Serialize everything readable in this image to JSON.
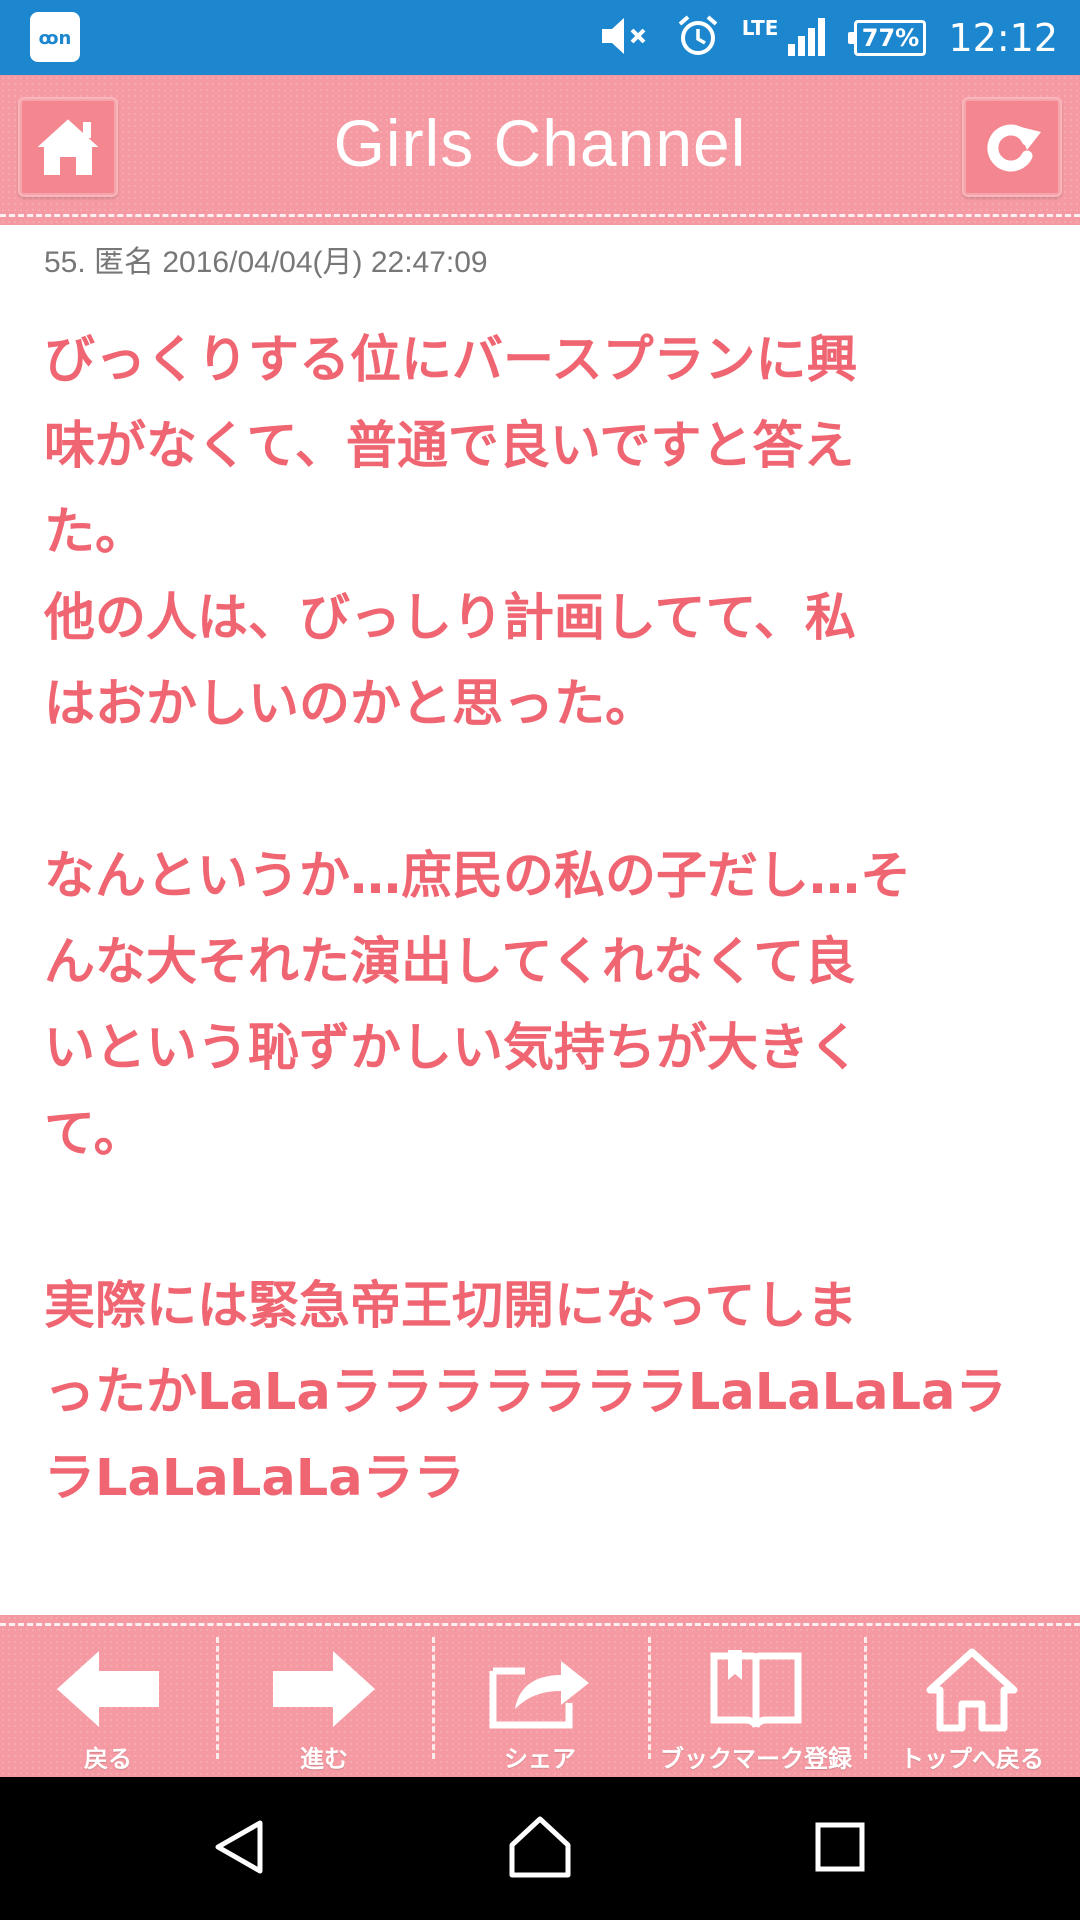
{
  "status_bar": {
    "time": "12:12",
    "network": "LTE",
    "battery": "77%",
    "icons": [
      "app-notification-icon",
      "volume-muted-icon",
      "alarm-icon",
      "signal-icon",
      "battery-icon"
    ]
  },
  "header": {
    "title": "Girls Channel",
    "home_icon": "home-icon",
    "reload_icon": "reload-icon"
  },
  "comment": {
    "meta": "55. 匿名 2016/04/04(月) 22:47:09",
    "paragraphs": [
      "びっくりする位にバースプランに興\n味がなくて、普通で良いですと答え\nた。\n他の人は、びっしり計画してて、私\nはおかしいのかと思った。",
      "なんというか…庶民の私の子だし…そ\nんな大それた演出してくれなくて良\nいという恥ずかしい気持ちが大きく\nて。",
      "実際には緊急帝王切開になってしま\nったかLaLaラララララララLaLaLaLaラ\nラLaLaLaLaララ"
    ]
  },
  "toolbar": {
    "back": "戻る",
    "forward": "進む",
    "share": "シェア",
    "bookmark": "ブックマーク登録",
    "top": "トップへ戻る"
  },
  "colors": {
    "status_bar": "#1c87cf",
    "header": "#f59aa2",
    "text_pink": "#ef6672",
    "meta_gray": "#777777"
  }
}
